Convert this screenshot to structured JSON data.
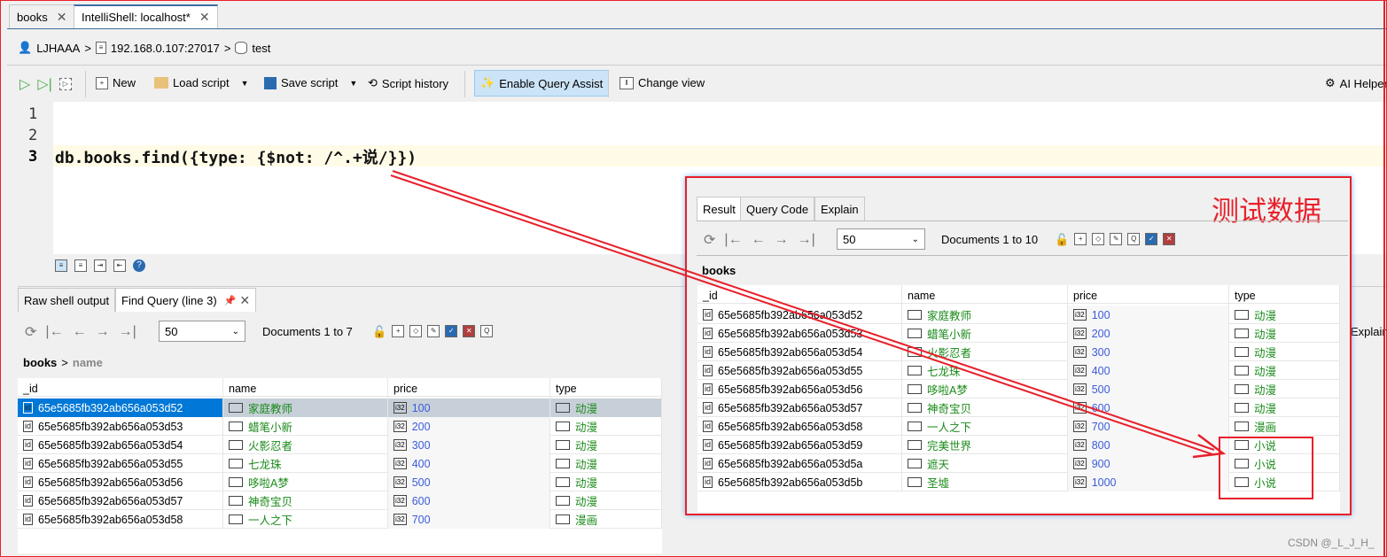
{
  "tabs": [
    {
      "label": "books",
      "active": false
    },
    {
      "label": "IntelliShell: localhost*",
      "active": true
    }
  ],
  "breadcrumb": {
    "user": "LJHAAA",
    "server": "192.168.0.107:27017",
    "database": "test"
  },
  "toolbar": {
    "new": "New",
    "load": "Load script",
    "save": "Save script",
    "history": "Script history",
    "assist": "Enable Query Assist",
    "change_view": "Change view",
    "ai": "AI Helper"
  },
  "editor": {
    "line_numbers": [
      "1",
      "2",
      "3"
    ],
    "code": "db.books.find({type: {$not: /^.+说/}})"
  },
  "results": {
    "tabs": [
      "Raw shell output",
      "Find Query (line 3)"
    ],
    "page_size": "50",
    "doc_count": "Documents 1 to 7",
    "path_collection": "books",
    "path_field": "name",
    "columns": [
      "_id",
      "name",
      "price",
      "type"
    ],
    "rows": [
      [
        "65e5685fb392ab656a053d52",
        "家庭教师",
        "100",
        "动漫"
      ],
      [
        "65e5685fb392ab656a053d53",
        "蜡笔小新",
        "200",
        "动漫"
      ],
      [
        "65e5685fb392ab656a053d54",
        "火影忍者",
        "300",
        "动漫"
      ],
      [
        "65e5685fb392ab656a053d55",
        "七龙珠",
        "400",
        "动漫"
      ],
      [
        "65e5685fb392ab656a053d56",
        "哆啦A梦",
        "500",
        "动漫"
      ],
      [
        "65e5685fb392ab656a053d57",
        "神奇宝贝",
        "600",
        "动漫"
      ],
      [
        "65e5685fb392ab656a053d58",
        "一人之下",
        "700",
        "漫画"
      ]
    ],
    "right_clipped": "Explain Qu"
  },
  "overlay": {
    "label": "测试数据",
    "tabs": [
      "Result",
      "Query Code",
      "Explain"
    ],
    "page_size": "50",
    "doc_count": "Documents 1 to 10",
    "collection": "books",
    "columns": [
      "_id",
      "name",
      "price",
      "type"
    ],
    "rows": [
      [
        "65e5685fb392ab656a053d52",
        "家庭教师",
        "100",
        "动漫"
      ],
      [
        "65e5685fb392ab656a053d53",
        "蜡笔小新",
        "200",
        "动漫"
      ],
      [
        "65e5685fb392ab656a053d54",
        "火影忍者",
        "300",
        "动漫"
      ],
      [
        "65e5685fb392ab656a053d55",
        "七龙珠",
        "400",
        "动漫"
      ],
      [
        "65e5685fb392ab656a053d56",
        "哆啦A梦",
        "500",
        "动漫"
      ],
      [
        "65e5685fb392ab656a053d57",
        "神奇宝贝",
        "600",
        "动漫"
      ],
      [
        "65e5685fb392ab656a053d58",
        "一人之下",
        "700",
        "漫画"
      ],
      [
        "65e5685fb392ab656a053d59",
        "完美世界",
        "800",
        "小说"
      ],
      [
        "65e5685fb392ab656a053d5a",
        "遮天",
        "900",
        "小说"
      ],
      [
        "65e5685fb392ab656a053d5b",
        "圣墟",
        "1000",
        "小说"
      ]
    ]
  },
  "watermark": "CSDN @_L_J_H_",
  "colors": {
    "annotation": "#e8202a",
    "selection": "#0078d7",
    "string": "#1a8a1a",
    "number": "#3b5bdb"
  }
}
